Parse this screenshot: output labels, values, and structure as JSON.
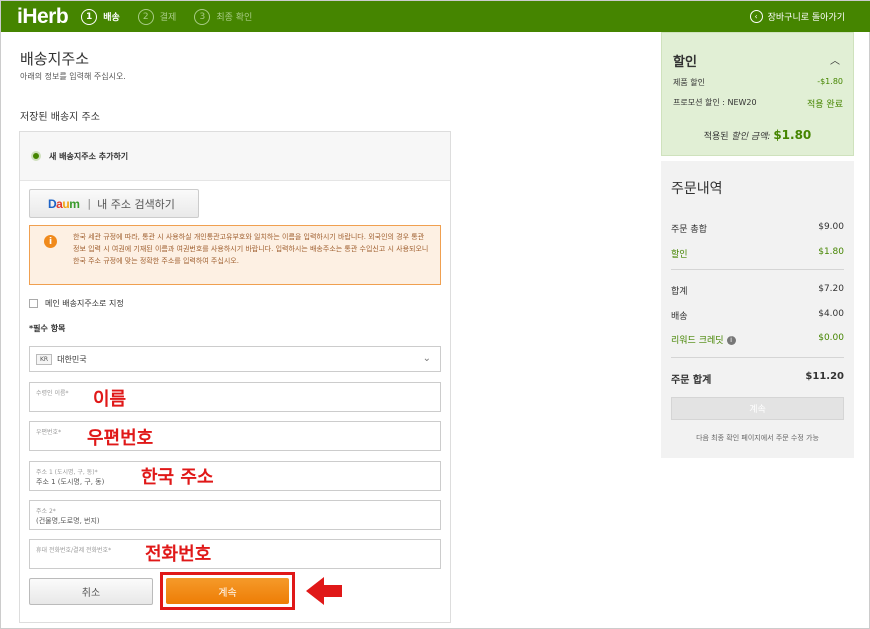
{
  "header": {
    "logo": "iHerb",
    "steps": [
      {
        "num": "1",
        "label": "배송"
      },
      {
        "num": "2",
        "label": "결제"
      },
      {
        "num": "3",
        "label": "최종 확인"
      }
    ],
    "back_label": "장바구니로 돌아가기"
  },
  "page": {
    "title": "배송지주소",
    "subtitle": "아래의 정보를 입력해 주십시오.",
    "saved_title": "저장된 배송지 주소"
  },
  "form": {
    "new_address_label": "새 배송지주소 추가하기",
    "daum_logo": {
      "a": "D",
      "b": "a",
      "c": "u",
      "d": "m"
    },
    "daum_search_label": "내 주소 검색하기",
    "warning_text": "한국 세관 규정에 따라, 통관 시 사용하실 개인통관고유부호와 일치하는 이름을 입력하시기 바랍니다. 외국인의 경우 통관 정보 입력 시 여권에 기재된 이름과 여권번호를 사용하시기 바랍니다. 입력하시는 배송주소는 통관 수입신고 시 사용되오니 한국 주소 규정에 맞는 정확한 주소를 입력하여 주십시오.",
    "default_address_label": "메인 배송지주소로 지정",
    "required_label": "*필수 항목",
    "country_code": "KR",
    "country_name": "대한민국",
    "fields": {
      "name": {
        "placeholder": "수령인 이름*",
        "annotation": "이름"
      },
      "postal": {
        "placeholder": "우편번호*",
        "annotation": "우편번호"
      },
      "address1": {
        "placeholder": "주소 1 (도시명, 구, 동)*",
        "value": "주소 1 (도시명, 구, 동)",
        "annotation": "한국 주소"
      },
      "address2": {
        "placeholder": "주소 2*",
        "value": "(건물명,도로명, 번지)"
      },
      "phone": {
        "placeholder": "휴대 전화번호/결제 전화번호*",
        "annotation": "전화번호"
      }
    },
    "cancel_label": "취소",
    "continue_label": "계속"
  },
  "discount": {
    "title": "할인",
    "rows": [
      {
        "label": "제품 할인",
        "value": "-$1.80"
      },
      {
        "label": "프로모션 할인 : NEW20",
        "value": "적용 완료"
      }
    ],
    "applied_prefix": "적용된",
    "applied_italic": "할인 금액:",
    "applied_value": "$1.80"
  },
  "summary": {
    "title": "주문내역",
    "subtotal_label": "주문 총합",
    "subtotal_value": "$9.00",
    "discount_label": "할인",
    "discount_value": "$1.80",
    "total_label": "합계",
    "total_value": "$7.20",
    "shipping_label": "배송",
    "shipping_value": "$4.00",
    "reward_label": "리워드 크레딧",
    "reward_value": "$0.00",
    "grand_label": "주문 합계",
    "grand_value": "$11.20",
    "button_label": "계속",
    "note": "다음 최종 확인 페이지에서 주문 수정 가능"
  },
  "colors": {
    "brand": "#458500",
    "accent": "#ee7d05",
    "annotation": "#e01818"
  }
}
